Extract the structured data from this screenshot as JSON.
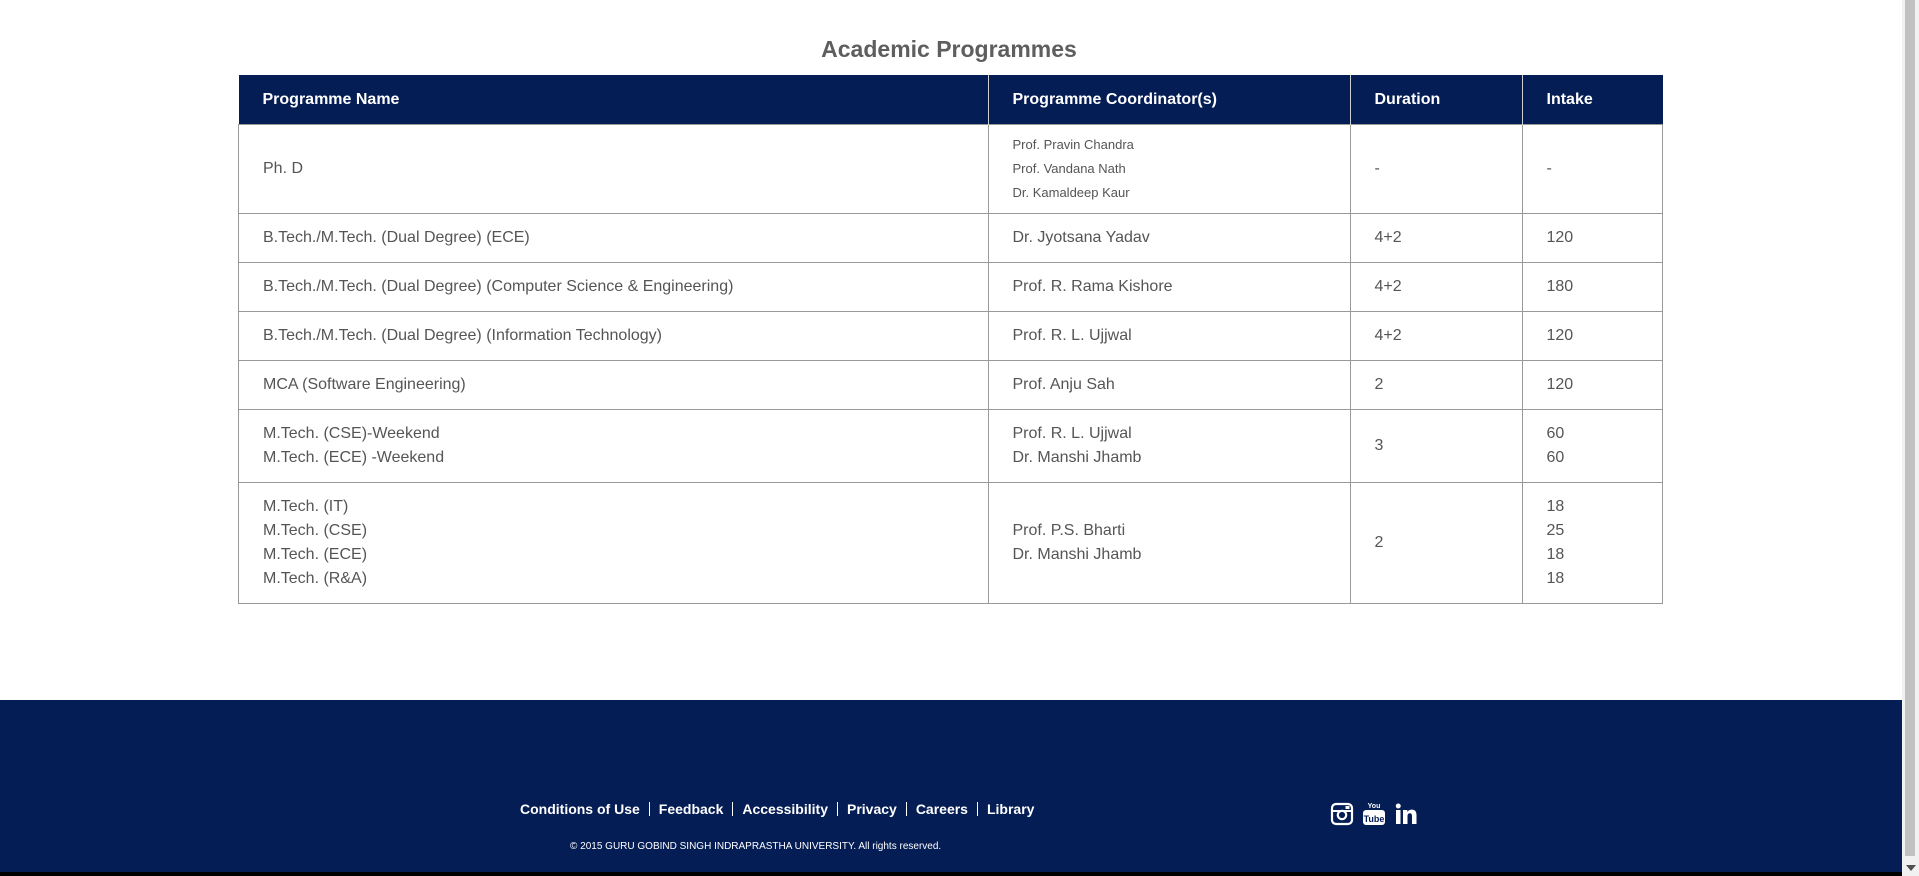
{
  "title": "Academic Programmes",
  "table": {
    "headers": [
      "Programme Name",
      "Programme Coordinator(s)",
      "Duration",
      "Intake"
    ],
    "rows": [
      {
        "name": [
          "Ph. D"
        ],
        "coord": [
          "Prof. Pravin Chandra",
          "Prof. Vandana Nath",
          "Dr. Kamaldeep Kaur"
        ],
        "duration": "-",
        "intake": [
          "-"
        ]
      },
      {
        "name": [
          "B.Tech./M.Tech. (Dual Degree) (ECE)"
        ],
        "coord": [
          "Dr. Jyotsana Yadav"
        ],
        "duration": "4+2",
        "intake": [
          "120"
        ]
      },
      {
        "name": [
          "B.Tech./M.Tech. (Dual Degree) (Computer Science & Engineering)"
        ],
        "coord": [
          "Prof. R. Rama Kishore"
        ],
        "duration": "4+2",
        "intake": [
          "180"
        ]
      },
      {
        "name": [
          "B.Tech./M.Tech. (Dual Degree) (Information Technology)"
        ],
        "coord": [
          "Prof. R. L. Ujjwal"
        ],
        "duration": "4+2",
        "intake": [
          "120"
        ]
      },
      {
        "name": [
          "MCA (Software Engineering)"
        ],
        "coord": [
          "Prof. Anju Sah"
        ],
        "duration": "2",
        "intake": [
          "120"
        ]
      },
      {
        "name": [
          "M.Tech. (CSE)-Weekend",
          "M.Tech. (ECE) -Weekend"
        ],
        "coord": [
          "Prof. R. L. Ujjwal",
          "Dr. Manshi Jhamb"
        ],
        "duration": "3",
        "intake": [
          "60",
          "60"
        ]
      },
      {
        "name": [
          "M.Tech. (IT)",
          "M.Tech. (CSE)",
          "M.Tech. (ECE)",
          "M.Tech. (R&A)"
        ],
        "coord": [
          "Prof. P.S. Bharti",
          "Dr. Manshi Jhamb"
        ],
        "duration": "2",
        "intake": [
          "18",
          "25",
          "18",
          "18"
        ]
      }
    ]
  },
  "footer": {
    "links": [
      "Conditions of Use",
      "Feedback",
      "Accessibility",
      "Privacy",
      "Careers",
      "Library"
    ],
    "copyright": "© 2015 GURU GOBIND SINGH INDRAPRASTHA UNIVERSITY. All rights reserved.",
    "social_icons": [
      "instagram-icon",
      "youtube-icon",
      "linkedin-icon"
    ]
  },
  "colors": {
    "brand_navy": "#051d55"
  }
}
